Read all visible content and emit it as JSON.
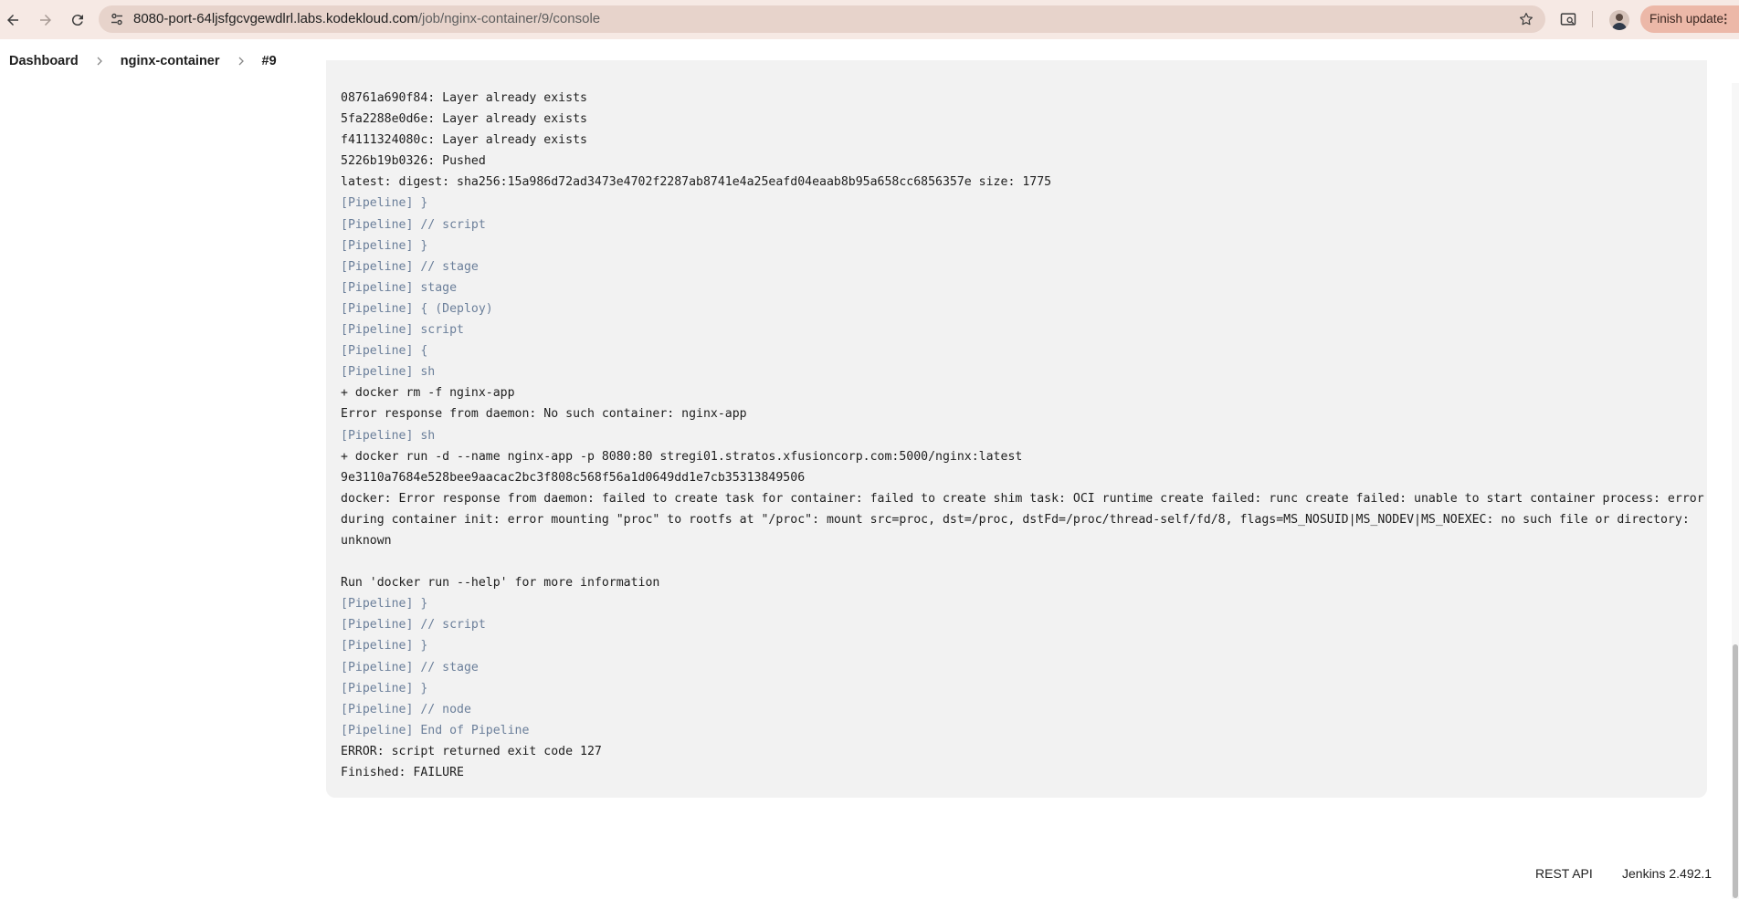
{
  "browser": {
    "url_host": "8080-port-64ljsfgcvgewdlrl.labs.kodekloud.com",
    "url_path": "/job/nginx-container/9/console",
    "finish_update_label": "Finish update"
  },
  "breadcrumb": {
    "items": [
      "Dashboard",
      "nginx-container",
      "#9"
    ]
  },
  "console": {
    "lines": [
      {
        "text": "08761a690f84: Layer already exists",
        "pipeline": false
      },
      {
        "text": "5fa2288e0d6e: Layer already exists",
        "pipeline": false
      },
      {
        "text": "f4111324080c: Layer already exists",
        "pipeline": false
      },
      {
        "text": "5226b19b0326: Pushed",
        "pipeline": false
      },
      {
        "text": "latest: digest: sha256:15a986d72ad3473e4702f2287ab8741e4a25eafd04eaab8b95a658cc6856357e size: 1775",
        "pipeline": false
      },
      {
        "text": "[Pipeline] }",
        "pipeline": true
      },
      {
        "text": "[Pipeline] // script",
        "pipeline": true
      },
      {
        "text": "[Pipeline] }",
        "pipeline": true
      },
      {
        "text": "[Pipeline] // stage",
        "pipeline": true
      },
      {
        "text": "[Pipeline] stage",
        "pipeline": true
      },
      {
        "text": "[Pipeline] { (Deploy)",
        "pipeline": true
      },
      {
        "text": "[Pipeline] script",
        "pipeline": true
      },
      {
        "text": "[Pipeline] {",
        "pipeline": true
      },
      {
        "text": "[Pipeline] sh",
        "pipeline": true
      },
      {
        "text": "+ docker rm -f nginx-app",
        "pipeline": false
      },
      {
        "text": "Error response from daemon: No such container: nginx-app",
        "pipeline": false
      },
      {
        "text": "[Pipeline] sh",
        "pipeline": true
      },
      {
        "text": "+ docker run -d --name nginx-app -p 8080:80 stregi01.stratos.xfusioncorp.com:5000/nginx:latest",
        "pipeline": false
      },
      {
        "text": "9e3110a7684e528bee9aacac2bc3f808c568f56a1d0649dd1e7cb35313849506",
        "pipeline": false
      },
      {
        "text": "docker: Error response from daemon: failed to create task for container: failed to create shim task: OCI runtime create failed: runc create failed: unable to start container process: error",
        "pipeline": false
      },
      {
        "text": "during container init: error mounting \"proc\" to rootfs at \"/proc\": mount src=proc, dst=/proc, dstFd=/proc/thread-self/fd/8, flags=MS_NOSUID|MS_NODEV|MS_NOEXEC: no such file or directory:",
        "pipeline": false
      },
      {
        "text": "unknown",
        "pipeline": false
      },
      {
        "text": "",
        "pipeline": false
      },
      {
        "text": "Run 'docker run --help' for more information",
        "pipeline": false
      },
      {
        "text": "[Pipeline] }",
        "pipeline": true
      },
      {
        "text": "[Pipeline] // script",
        "pipeline": true
      },
      {
        "text": "[Pipeline] }",
        "pipeline": true
      },
      {
        "text": "[Pipeline] // stage",
        "pipeline": true
      },
      {
        "text": "[Pipeline] }",
        "pipeline": true
      },
      {
        "text": "[Pipeline] // node",
        "pipeline": true
      },
      {
        "text": "[Pipeline] End of Pipeline",
        "pipeline": true
      },
      {
        "text": "ERROR: script returned exit code 127",
        "pipeline": false
      },
      {
        "text": "Finished: FAILURE",
        "pipeline": false
      }
    ]
  },
  "footer": {
    "rest_api_label": "REST API",
    "version_label": "Jenkins 2.492.1"
  },
  "icons": {
    "back": "back-arrow-icon",
    "forward": "forward-arrow-icon",
    "reload": "reload-icon",
    "site_info": "tune-icon",
    "bookmark": "star-icon",
    "search_tab": "tab-search-icon",
    "profile": "avatar",
    "menu": "more-vert-icon",
    "breadcrumb_sep": "chevron-right-icon"
  },
  "colors": {
    "chrome_bg": "#f6e9e4",
    "omnibox_bg": "#e7d3cb",
    "finish_update_bg": "#ecb8a8",
    "console_bg": "#f2f2f2",
    "pipeline_text": "#6b7f9a"
  }
}
